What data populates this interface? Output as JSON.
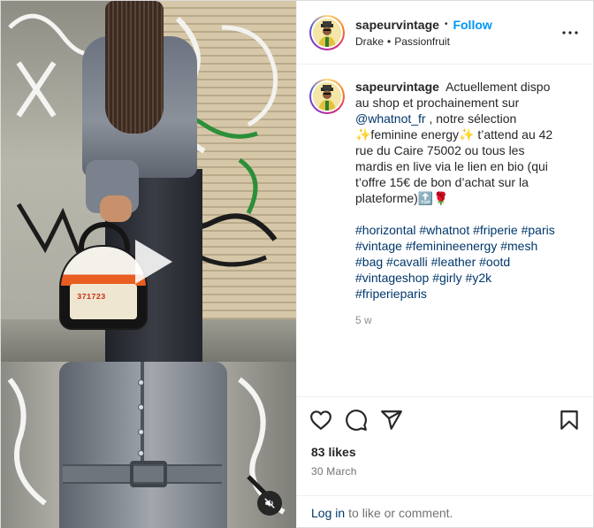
{
  "post": {
    "username": "sapeurvintage",
    "follow_label": "Follow",
    "separator": "•",
    "audio": {
      "artist": "Drake",
      "track": "Passionfruit"
    },
    "caption": {
      "text_before_mention": "Actuellement dispo au shop et prochainement sur",
      "mention": "@whatnot_fr",
      "text_after_mention": ", notre sélection ✨feminine energy✨ t’attend au 42 rue du Caire 75002 ou tous les mardis en live via le lien en bio (qui t’offre 15€ de bon d’achat sur la plateforme)🔝🌹",
      "hashtags": [
        "#horizontal",
        "#whatnot",
        "#friperie",
        "#paris",
        "#vintage",
        "#feminineenergy",
        "#mesh",
        "#bag",
        "#cavalli",
        "#leather",
        "#ootd",
        "#vintageshop",
        "#girly",
        "#y2k",
        "#friperieparis"
      ],
      "age": "5 w"
    },
    "likes": "83 likes",
    "date": "30 March",
    "comment": {
      "login_label": "Log in",
      "rest": "to like or comment."
    },
    "media": {
      "bag_number": "371723"
    }
  },
  "icons": {
    "like": "heart-icon",
    "comment": "comment-icon",
    "share": "share-icon",
    "save": "bookmark-icon",
    "more": "more-icon",
    "play": "play-icon",
    "mute": "muted-icon"
  },
  "colors": {
    "follow": "#0095f6",
    "link": "#00376b",
    "secondary_text": "#737373",
    "border": "#dbdbdb"
  }
}
